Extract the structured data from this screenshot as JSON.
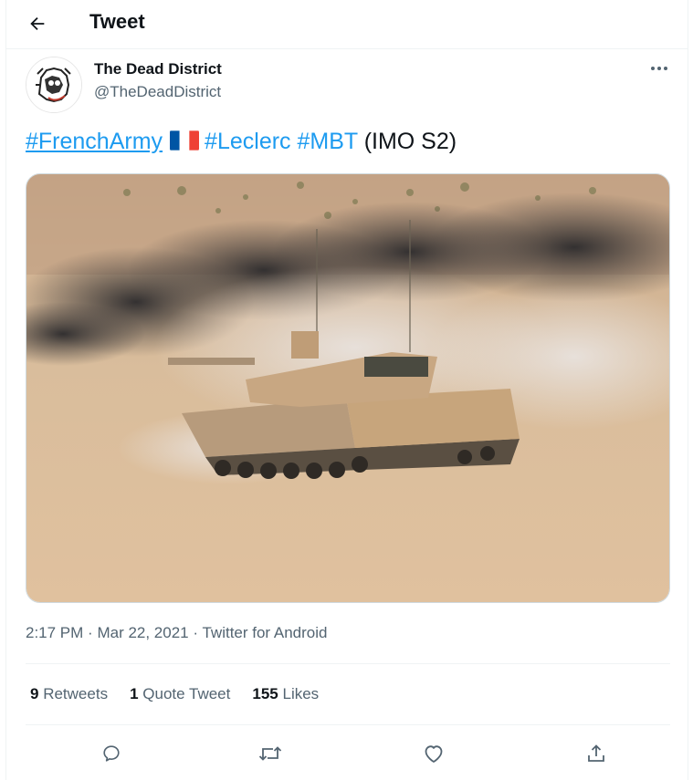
{
  "header": {
    "title": "Tweet",
    "back_icon": "arrow-left-icon"
  },
  "author": {
    "name": "The Dead District",
    "handle": "@TheDeadDistrict"
  },
  "tweet": {
    "hashtag1": "#FrenchArmy",
    "flag_icon": "french-flag-icon",
    "hashtag2": "#Leclerc",
    "hashtag3": "#MBT",
    "rest": "(IMO S2)"
  },
  "meta": {
    "time": "2:17 PM",
    "separator": "·",
    "date": "Mar 22, 2021",
    "source": "Twitter for Android"
  },
  "stats": {
    "retweets_count": "9",
    "retweets_label": "Retweets",
    "quotes_count": "1",
    "quotes_label": "Quote Tweet",
    "likes_count": "155",
    "likes_label": "Likes"
  },
  "actions": [
    "reply-icon",
    "retweet-icon",
    "like-icon",
    "share-icon"
  ],
  "colors": {
    "link": "#1d9bf0",
    "muted": "#536471",
    "text": "#0f1419",
    "border": "#eff3f4"
  }
}
